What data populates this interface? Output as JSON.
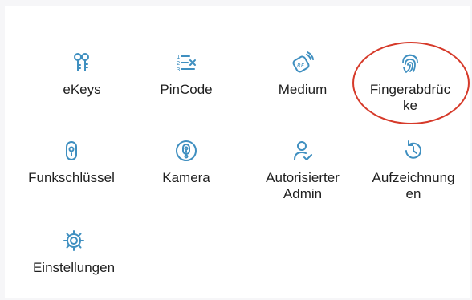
{
  "accent_color": "#3f8fc0",
  "highlight_color": "#d63a2a",
  "menu": {
    "items": [
      {
        "label": "eKeys",
        "icon": "keys-icon"
      },
      {
        "label": "PinCode",
        "icon": "pincode-icon"
      },
      {
        "label": "Medium",
        "icon": "rf-card-icon"
      },
      {
        "label": "Fingerabdrüc\nke",
        "icon": "fingerprint-icon"
      },
      {
        "label": "Funkschlüssel",
        "icon": "remote-key-icon"
      },
      {
        "label": "Kamera",
        "icon": "camera-icon"
      },
      {
        "label": "Autorisierter\nAdmin",
        "icon": "authorized-admin-icon"
      },
      {
        "label": "Aufzeichnung\nen",
        "icon": "history-icon"
      },
      {
        "label": "Einstellungen",
        "icon": "settings-gear-icon"
      }
    ]
  }
}
